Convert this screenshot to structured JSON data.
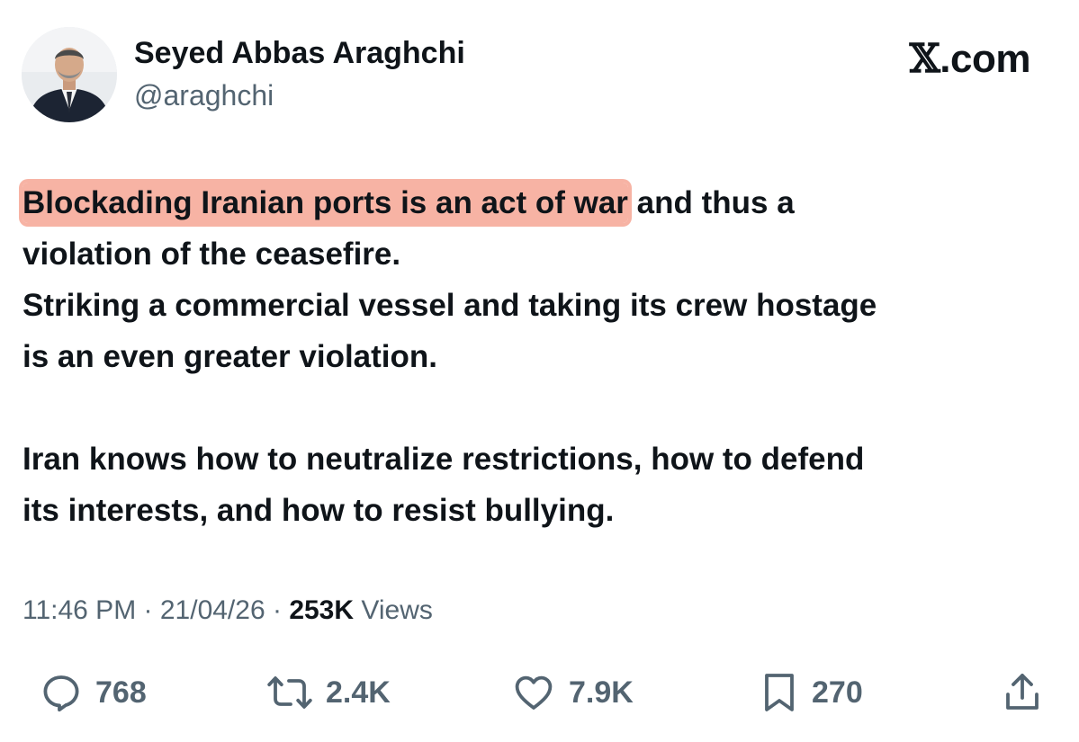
{
  "author": {
    "display_name": "Seyed Abbas Araghchi",
    "handle": "@araghchi",
    "avatar_icon": "profile-photo"
  },
  "brand": {
    "label": ".com",
    "icon": "x-logo-icon",
    "glyph": "𝕏"
  },
  "tweet": {
    "line1_highlight": "Blockading Iranian ports is an act of war",
    "line1_rest": " and thus a",
    "line2": "violation of the ceasefire.",
    "line3": "Striking a commercial vessel and taking its crew hostage",
    "line4": "is an even greater violation.",
    "line5": "Iran knows how to neutralize restrictions, how to defend",
    "line6": "its interests, and how to resist bullying.",
    "highlight_color": "#f7b3a4"
  },
  "meta": {
    "time": "11:46 PM",
    "separator": " · ",
    "date": "21/04/26",
    "views_count": "253K",
    "views_label": "Views"
  },
  "actions": {
    "replies": "768",
    "reposts": "2.4K",
    "likes": "7.9K",
    "bookmarks": "270"
  },
  "colors": {
    "text": "#0f1419",
    "secondary": "#536471"
  }
}
